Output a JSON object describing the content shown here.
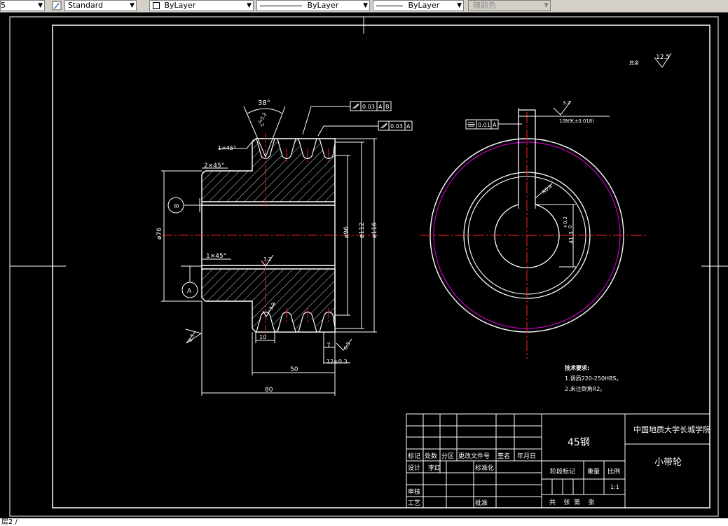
{
  "toolbar": {
    "layer_value": "5",
    "textstyle_value": "Standard",
    "color_value": "ByLayer",
    "linetype_value": "ByLayer",
    "lineweight_value": "ByLayer",
    "plotstyle_value": "随颜色"
  },
  "drawing": {
    "surface_finish_label": "其余",
    "surface_finish_value": "12.5",
    "dims": {
      "angle": "38°",
      "chamfer_top": "1×45°",
      "chamfer_left": "2×45°",
      "chamfer_bore": "1×45°",
      "dia_76": "ø76",
      "dia_96": "ø96",
      "dia_112": "ø112",
      "dia_116": "ø116",
      "len_10": "10",
      "len_7": "7",
      "len_12": "12±0.3",
      "len_50": "50",
      "len_80": "80",
      "rough_32": "3.2",
      "rough_63": "6.3",
      "key_width": "10N9(±0.018)",
      "key_depth": "41.3",
      "key_depth_tol": "+0.2\n0",
      "fillet": "R0.4"
    },
    "datums": {
      "a": "A",
      "b": "B"
    },
    "tolerances": {
      "runout_ab": [
        "0.03",
        "A",
        "B"
      ],
      "runout_a": [
        "0.03",
        "A"
      ],
      "symmetry": [
        "0.01",
        "A"
      ]
    },
    "tech_req": {
      "title": "技术要求:",
      "line1": "1.调质220-250HBS。",
      "line2": "2.未注倒角R2。"
    }
  },
  "title_block": {
    "material": "45钢",
    "school": "中国地质大学长城学院",
    "part_name": "小带轮",
    "headers": [
      "标记",
      "处数",
      "分区",
      "更改文件号",
      "签名",
      "年月日"
    ],
    "design_label": "设计",
    "designer": "李红",
    "standard_label": "标准化",
    "review_label": "审核",
    "process_label": "工艺",
    "approve_label": "批准",
    "stage_label": "阶段标记",
    "weight_label": "重量",
    "scale_label": "比例",
    "scale_value": "1:1",
    "sheet_text": "共    张  第    张"
  },
  "command_line": {
    "text": "层2 /"
  },
  "colors": {
    "background": "#000000",
    "line": "#ffffff",
    "center": "#ff2020",
    "magenta": "#c000c0",
    "toolbar": "#d4d0c8"
  }
}
